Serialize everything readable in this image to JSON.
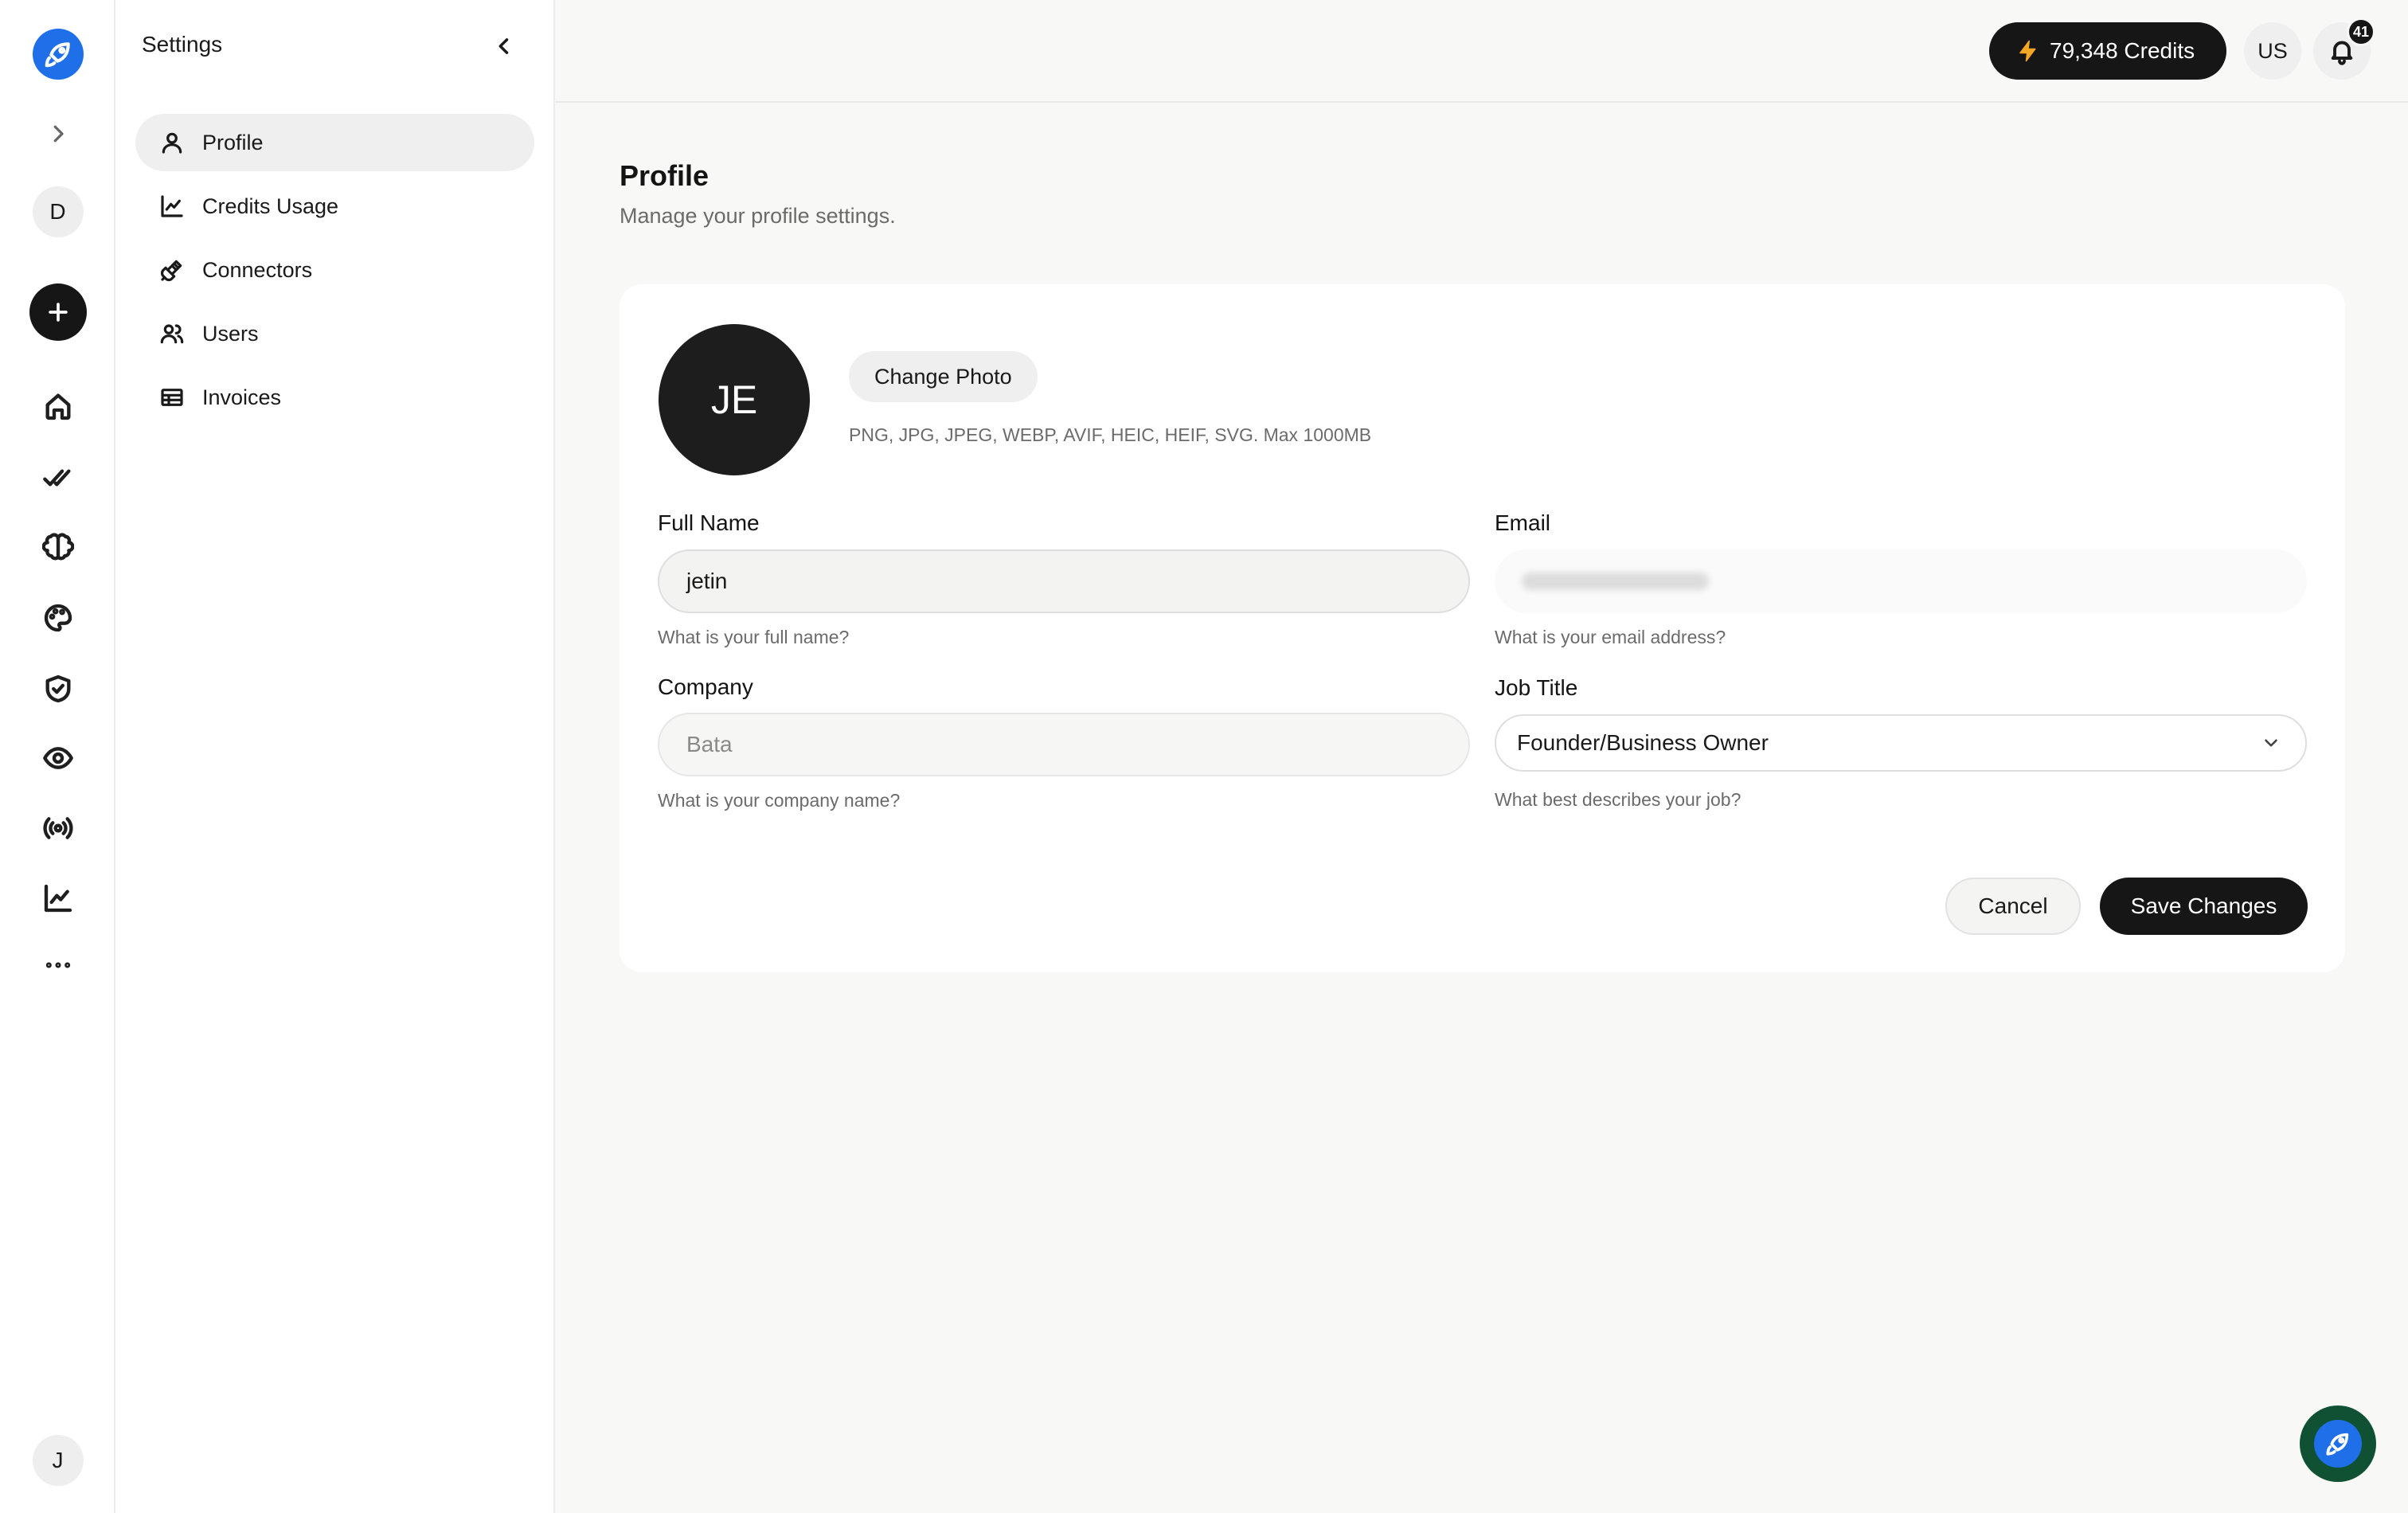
{
  "sidebar": {
    "user_initial": "D",
    "bottom_user_initial": "J"
  },
  "settings": {
    "title": "Settings",
    "items": [
      {
        "label": "Profile",
        "icon": "user-icon",
        "active": true
      },
      {
        "label": "Credits Usage",
        "icon": "chart-line-icon",
        "active": false
      },
      {
        "label": "Connectors",
        "icon": "plug-icon",
        "active": false
      },
      {
        "label": "Users",
        "icon": "users-icon",
        "active": false
      },
      {
        "label": "Invoices",
        "icon": "table-icon",
        "active": false
      }
    ]
  },
  "topbar": {
    "credits": "79,348 Credits",
    "language": "US",
    "notifications_count": "41"
  },
  "profile": {
    "title": "Profile",
    "subtitle": "Manage your profile settings.",
    "avatar_initials": "JE",
    "change_photo_label": "Change Photo",
    "file_hint": "PNG, JPG, JPEG, WEBP, AVIF, HEIC, HEIF, SVG. Max 1000MB",
    "full_name": {
      "label": "Full Name",
      "value": "jetin",
      "help": "What is your full name?"
    },
    "email": {
      "label": "Email",
      "help": "What is your email address?"
    },
    "company": {
      "label": "Company",
      "placeholder": "Bata",
      "help": "What is your company name?"
    },
    "job_title": {
      "label": "Job Title",
      "value": "Founder/Business Owner",
      "help": "What best describes your job?"
    },
    "cancel_label": "Cancel",
    "save_label": "Save Changes"
  },
  "colors": {
    "accent_blue": "#1f6fe8",
    "dark": "#161616",
    "credits_bolt": "#f5a623",
    "fab_ring": "#0f5132"
  }
}
